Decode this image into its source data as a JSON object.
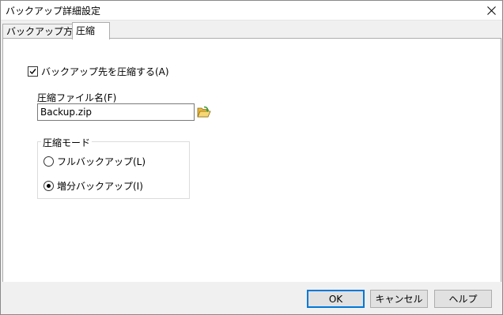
{
  "window": {
    "title": "バックアップ詳細設定"
  },
  "tabs": [
    {
      "label": "バックアップ方法",
      "active": false
    },
    {
      "label": "圧縮",
      "active": true
    }
  ],
  "compress": {
    "checkbox_label": "バックアップ先を圧縮する(A)",
    "checked": true,
    "filename_label": "圧縮ファイル名(F)",
    "filename_value": "Backup.zip",
    "mode_group_title": "圧縮モード",
    "modes": [
      {
        "label": "フルバックアップ(L)",
        "selected": false
      },
      {
        "label": "増分バックアップ(I)",
        "selected": true
      }
    ]
  },
  "buttons": {
    "ok": "OK",
    "cancel": "キャンセル",
    "help": "ヘルプ"
  },
  "colors": {
    "accent": "#0078d7",
    "folder": "#f2c94c",
    "arrow": "#3a9b3a"
  },
  "icons": {
    "close": "close-icon",
    "browse": "folder-open-icon"
  }
}
